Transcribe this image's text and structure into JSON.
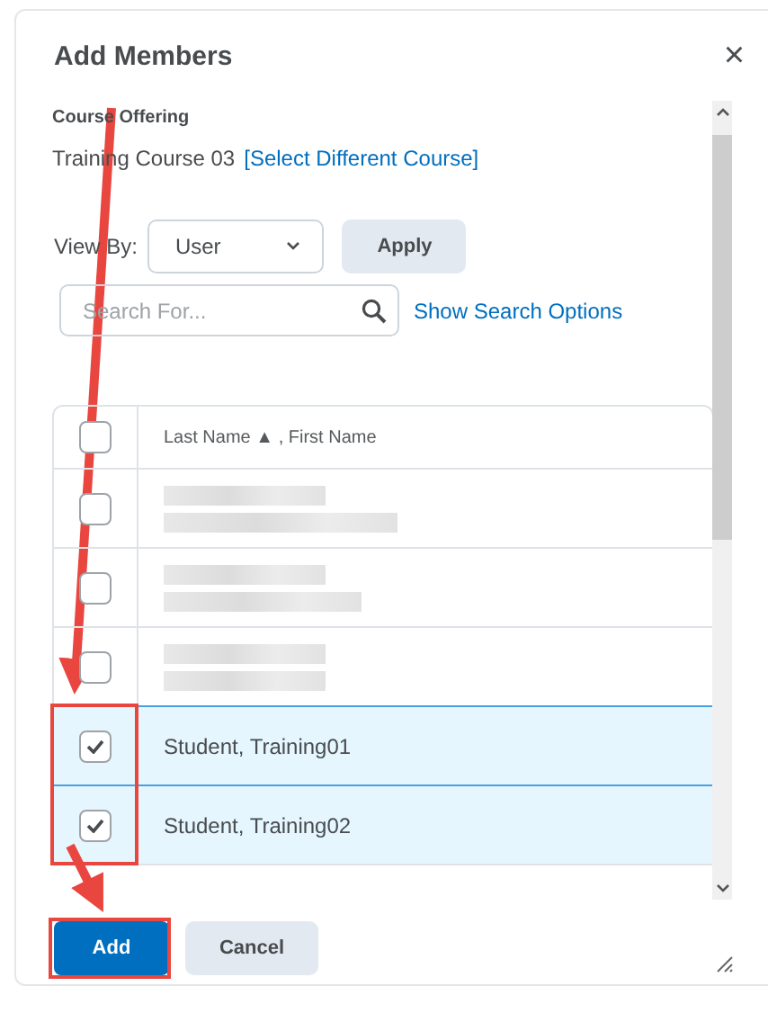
{
  "dialog": {
    "title": "Add Members",
    "close": "×"
  },
  "course": {
    "label": "Course Offering",
    "name": "Training Course 03",
    "link": "[Select Different Course]"
  },
  "view_by": {
    "label": "View By:",
    "value": "User",
    "apply": "Apply"
  },
  "search": {
    "placeholder": "Search For...",
    "options_link": "Show Search Options"
  },
  "table": {
    "header": {
      "checked": false,
      "column": "Last Name",
      "sort": "▲",
      "column_2": ", First Name"
    },
    "rows": [
      {
        "kind": "blurred",
        "checked": false
      },
      {
        "kind": "blurred",
        "checked": false
      },
      {
        "kind": "blurred",
        "checked": false
      },
      {
        "kind": "named",
        "name": "Student, Training01",
        "checked": true
      },
      {
        "kind": "named",
        "name": "Student, Training02",
        "checked": true
      }
    ]
  },
  "buttons": {
    "primary": "Add",
    "secondary": "Cancel"
  }
}
